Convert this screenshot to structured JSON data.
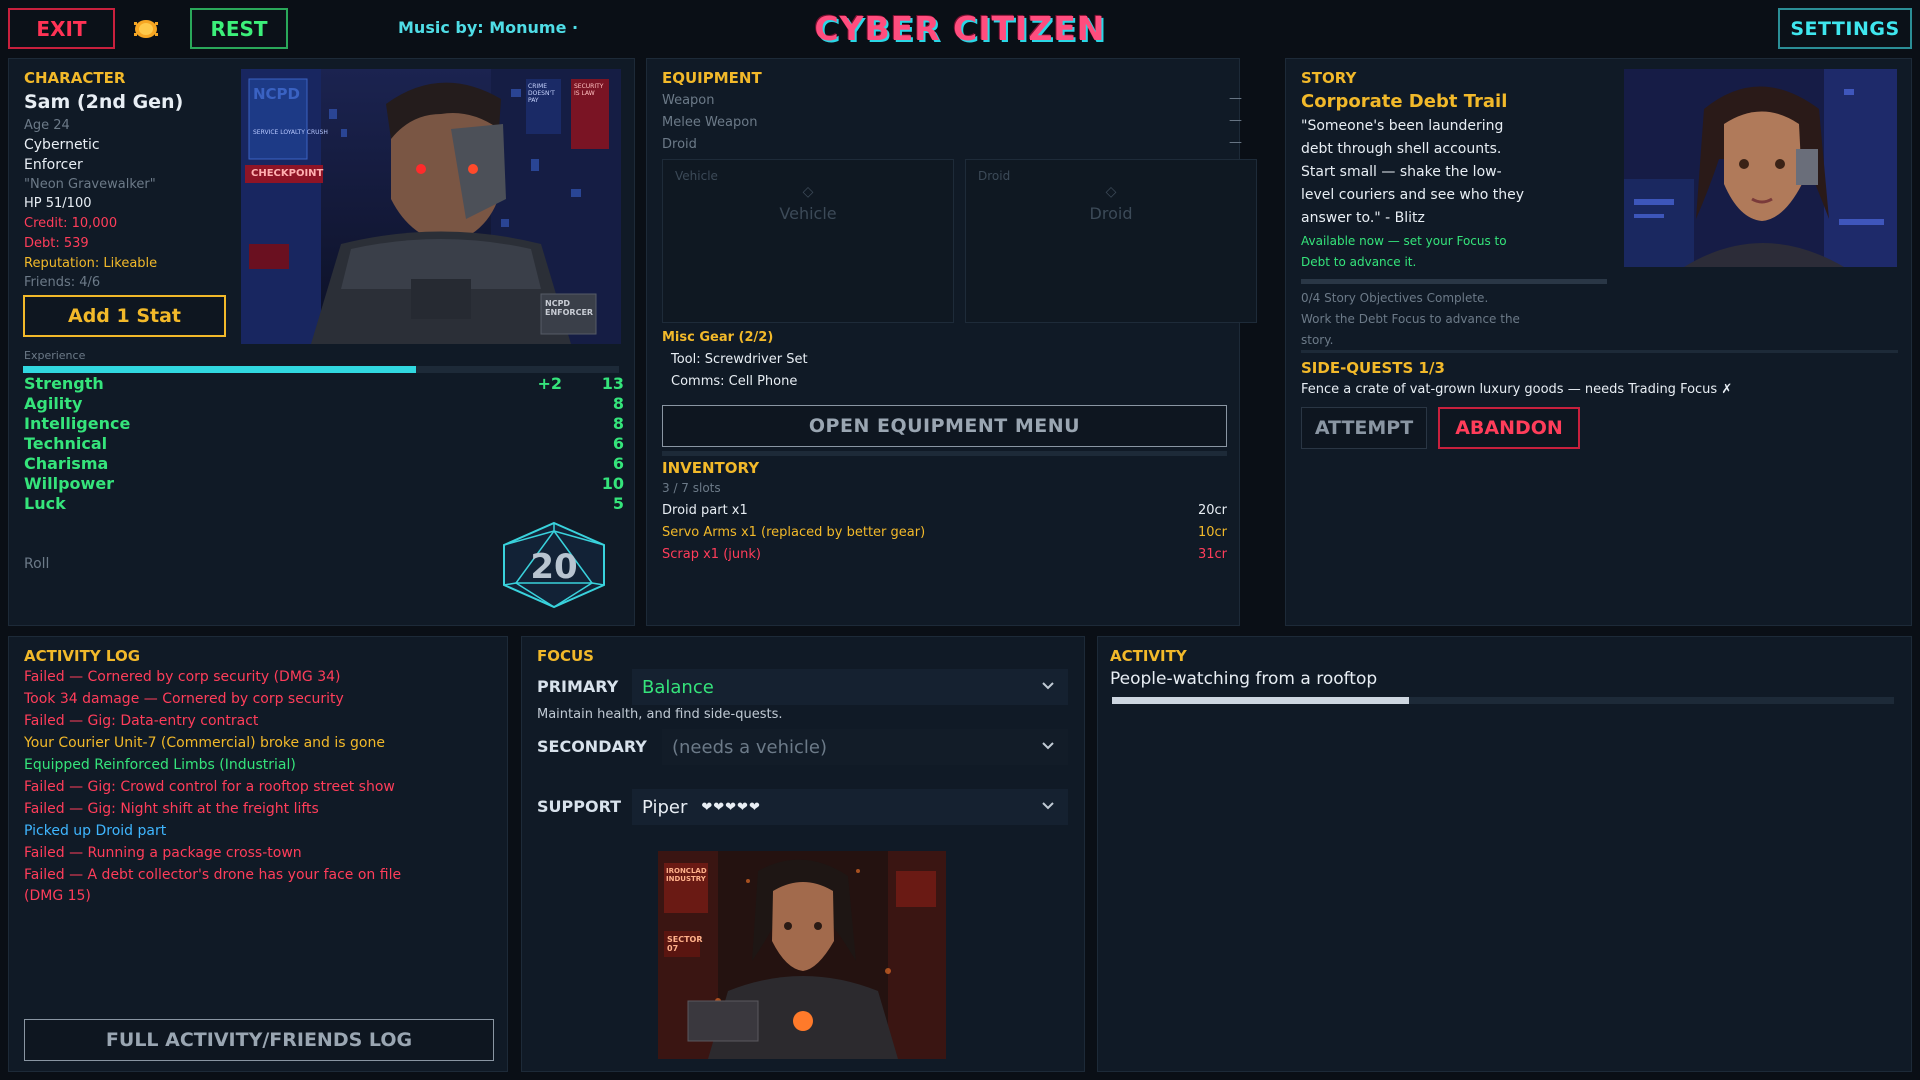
{
  "topbar": {
    "exit_label": "EXIT",
    "rest_label": "REST",
    "music_credit": "Music by: Monume ·",
    "title": "CYBER CITIZEN",
    "settings_label": "SETTINGS"
  },
  "character": {
    "section_title": "CHARACTER",
    "name": "Sam  (2nd Gen)",
    "age": "Age 24",
    "type": "Cybernetic",
    "role": "Enforcer",
    "nickname": "\"Neon Gravewalker\"",
    "hp": "HP 51/100",
    "credit": "Credit: 10,000",
    "debt": "Debt: 539",
    "reputation": "Reputation: Likeable",
    "friends": "Friends: 4/6",
    "add_stat_label": "Add 1 Stat",
    "experience_label": "Experience",
    "experience_fraction": 0.66,
    "portrait_signs": {
      "ncpd": "NCPD",
      "checkpoint": "CHECKPOINT",
      "service": "SERVICE LOYALTY CRUSH",
      "crime": "CRIME DOESN'T PAY",
      "security": "SECURITY IS LAW",
      "badge": "NCPD ENFORCER"
    },
    "stats": [
      {
        "name": "Strength",
        "bonus": "+2",
        "value": "13"
      },
      {
        "name": "Agility",
        "bonus": "",
        "value": "8"
      },
      {
        "name": "Intelligence",
        "bonus": "",
        "value": "8"
      },
      {
        "name": "Technical",
        "bonus": "",
        "value": "6"
      },
      {
        "name": "Charisma",
        "bonus": "",
        "value": "6"
      },
      {
        "name": "Willpower",
        "bonus": "",
        "value": "10"
      },
      {
        "name": "Luck",
        "bonus": "",
        "value": "5"
      }
    ],
    "roll_label": "Roll",
    "die_value": "20"
  },
  "equipment": {
    "section_title": "EQUIPMENT",
    "slots": [
      {
        "label": "Weapon",
        "value": "—"
      },
      {
        "label": "Melee Weapon",
        "value": "—"
      },
      {
        "label": "Droid",
        "value": "—"
      }
    ],
    "vehicle_box": {
      "label": "Vehicle",
      "name": "Vehicle"
    },
    "droid_box": {
      "label": "Droid",
      "name": "Droid"
    },
    "misc_title": "Misc Gear (2/2)",
    "misc_items": [
      "Tool: Screwdriver Set",
      "Comms: Cell Phone"
    ],
    "open_menu_label": "OPEN EQUIPMENT MENU"
  },
  "inventory": {
    "section_title": "INVENTORY",
    "slots_text": "3 / 7 slots",
    "items": [
      {
        "name": "Droid part x1",
        "price": "20cr",
        "status": "normal"
      },
      {
        "name": "Servo Arms x1 (replaced by better gear)",
        "price": "10cr",
        "status": "replaced"
      },
      {
        "name": "Scrap x1 (junk)",
        "price": "31cr",
        "status": "junk"
      }
    ]
  },
  "story": {
    "section_title": "STORY",
    "quest_title": "Corporate Debt Trail",
    "quote_lines": [
      "\"Someone's been laundering",
      "debt through shell accounts.",
      "Start small — shake the low-",
      "level couriers and see who they",
      "answer to.\" - Blitz"
    ],
    "available_lines": [
      "Available now — set your Focus to",
      "Debt to advance it."
    ],
    "objectives": "0/4 Story Objectives Complete.",
    "hint_lines": [
      "Work the Debt Focus to advance the",
      "story."
    ],
    "side_title": "SIDE-QUESTS 1/3",
    "side_quest": "Fence a crate of vat-grown luxury goods — needs Trading Focus ✗",
    "attempt_label": "ATTEMPT",
    "abandon_label": "ABANDON"
  },
  "log": {
    "section_title": "ACTIVITY LOG",
    "entries": [
      {
        "text": "Failed — Cornered by corp security  (DMG 34)",
        "kind": "fail"
      },
      {
        "text": "Took 34 damage — Cornered by corp security",
        "kind": "fail"
      },
      {
        "text": "Failed — Gig: Data-entry contract",
        "kind": "fail"
      },
      {
        "text": "Your Courier Unit-7 (Commercial) broke and is gone",
        "kind": "warn"
      },
      {
        "text": "Equipped Reinforced Limbs (Industrial)",
        "kind": "good"
      },
      {
        "text": "Failed — Gig: Crowd control for a rooftop street show",
        "kind": "fail"
      },
      {
        "text": "Failed — Gig: Night shift at the freight lifts",
        "kind": "fail"
      },
      {
        "text": "Picked up Droid part",
        "kind": "info"
      },
      {
        "text": "Failed — Running a package cross-town",
        "kind": "fail"
      },
      {
        "text": "Failed — A debt collector's drone has your face on file",
        "kind": "fail"
      },
      {
        "text": "(DMG 15)",
        "kind": "fail"
      }
    ],
    "full_log_label": "FULL ACTIVITY/FRIENDS LOG"
  },
  "focus": {
    "section_title": "FOCUS",
    "primary_label": "PRIMARY",
    "primary_value": "Balance",
    "primary_desc": "Maintain health, and find side-quests.",
    "secondary_label": "SECONDARY",
    "secondary_value": "(needs a vehicle)",
    "support_label": "SUPPORT",
    "support_value": "Piper",
    "support_hearts": "❤❤❤❤❤",
    "portrait_signs": {
      "top": "IRONCLAD INDUSTRY",
      "sector": "SECTOR 07"
    }
  },
  "activity": {
    "section_title": "ACTIVITY",
    "current": "People-watching from a rooftop",
    "progress_fraction": 0.38
  },
  "colors": {
    "accent_cyan": "#39d2dc",
    "accent_yellow": "#f2b92a",
    "danger_red": "#ff3d5a",
    "good_green": "#35e47b",
    "info_blue": "#3fb6ff",
    "title_pink": "#ff4d7e"
  }
}
